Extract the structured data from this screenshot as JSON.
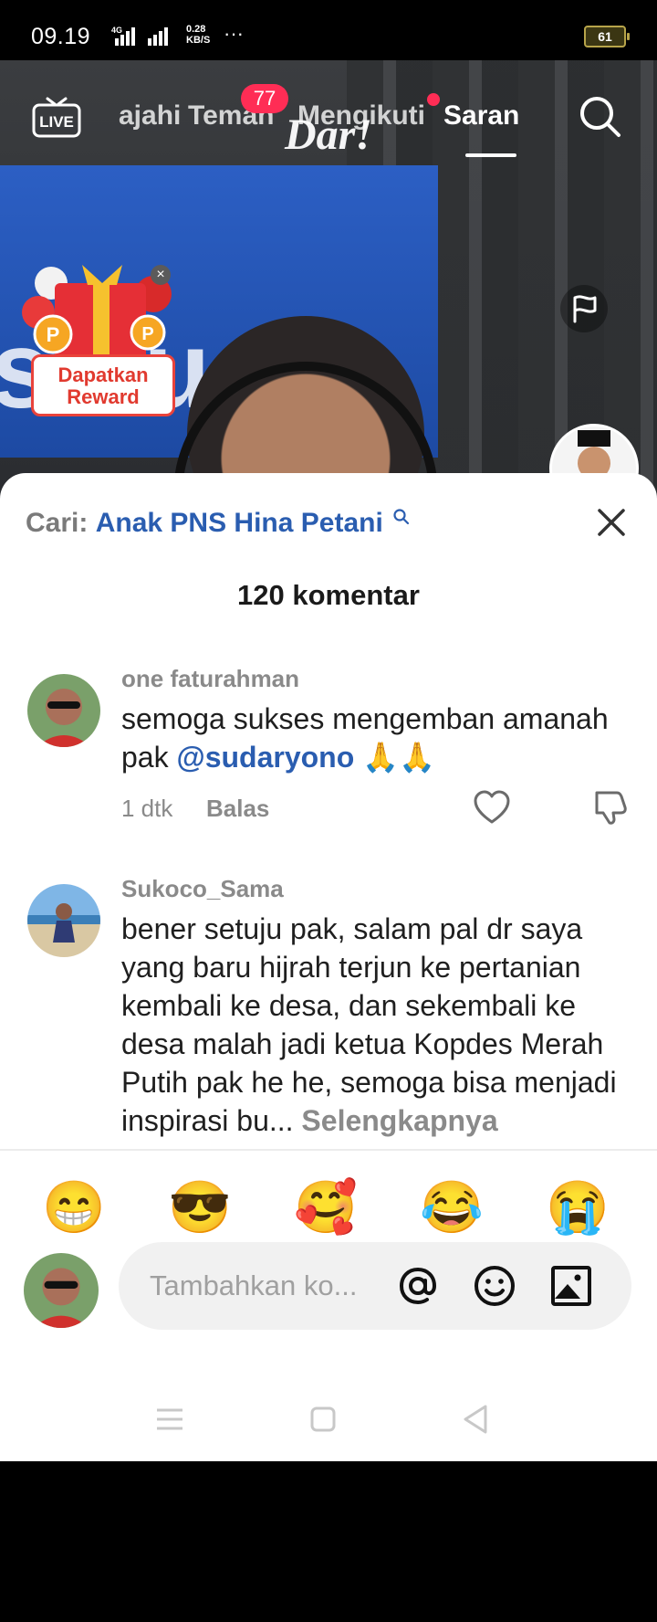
{
  "status_bar": {
    "time": "09.19",
    "network": "4G",
    "speed_value": "0.28",
    "speed_unit": "KB/S",
    "more": "···",
    "battery": "61"
  },
  "top_nav": {
    "tabs": [
      {
        "label": "ajahi",
        "active": false
      },
      {
        "label": "Teman",
        "active": false
      },
      {
        "label": "Mengikuti",
        "active": false
      },
      {
        "label": "Saran",
        "active": true
      }
    ],
    "friends_badge": "77",
    "icons": [
      "live-icon",
      "search-icon"
    ]
  },
  "video": {
    "watermark": "Dar!",
    "banner_text": "solusi",
    "reward": {
      "label_line1": "Dapatkan",
      "label_line2": "Reward",
      "close": "×"
    }
  },
  "comments_sheet": {
    "search_prefix": "Cari:",
    "search_query": "Anak PNS Hina Petani",
    "title": "120 komentar",
    "comments": [
      {
        "username": "one faturahman",
        "text": "semoga sukses mengemban amanah pak",
        "mention": "@sudaryono",
        "emoji": "🙏🙏",
        "time": "1 dtk",
        "reply_label": "Balas"
      },
      {
        "username": "Sukoco_Sama",
        "text": "bener setuju pak, salam pal dr saya yang baru hijrah terjun ke pertanian kembali ke desa, dan sekembali ke desa malah jadi ketua Kopdes Merah Putih pak he he, semoga bisa menjadi inspirasi bu...",
        "see_more": "Selengkapnya"
      }
    ]
  },
  "quick_emojis": [
    "😁",
    "😎",
    "🥰",
    "😂",
    "😭"
  ],
  "composer": {
    "placeholder": "Tambahkan ko...",
    "icons": [
      "mention-icon",
      "emoji-icon",
      "image-icon"
    ]
  },
  "system_nav": [
    "menu-icon",
    "home-icon",
    "back-icon"
  ]
}
